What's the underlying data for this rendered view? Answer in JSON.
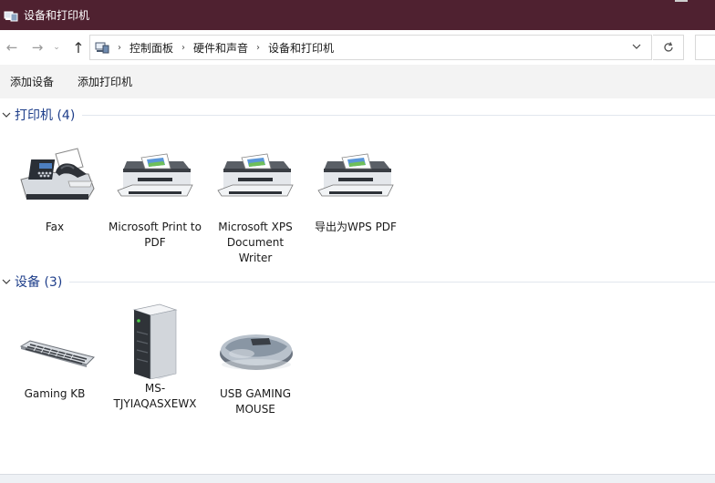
{
  "window": {
    "title": "设备和打印机"
  },
  "nav": {
    "back_icon": "arrow-left-icon",
    "forward_icon": "arrow-right-icon",
    "up_icon": "arrow-up-icon",
    "breadcrumbs": [
      "控制面板",
      "硬件和声音",
      "设备和打印机"
    ],
    "separator": "›",
    "refresh_icon": "refresh-icon"
  },
  "toolbar": {
    "add_device": "添加设备",
    "add_printer": "添加打印机"
  },
  "groups": [
    {
      "title": "打印机 (4)",
      "items": [
        {
          "label": "Fax",
          "icon": "fax-icon"
        },
        {
          "label": "Microsoft Print to PDF",
          "icon": "printer-icon"
        },
        {
          "label": "Microsoft XPS Document Writer",
          "icon": "printer-icon"
        },
        {
          "label": "导出为WPS PDF",
          "icon": "printer-icon"
        }
      ]
    },
    {
      "title": "设备 (3)",
      "items": [
        {
          "label": "Gaming KB",
          "icon": "keyboard-icon"
        },
        {
          "label": "MS-TJYIAQASXEWX",
          "icon": "computer-tower-icon"
        },
        {
          "label": "USB GAMING MOUSE",
          "icon": "mouse-icon"
        }
      ]
    }
  ],
  "colors": {
    "titlebar": "#4f2130",
    "group_title": "#1e3e8a",
    "command_bar": "#f3f3f3"
  }
}
